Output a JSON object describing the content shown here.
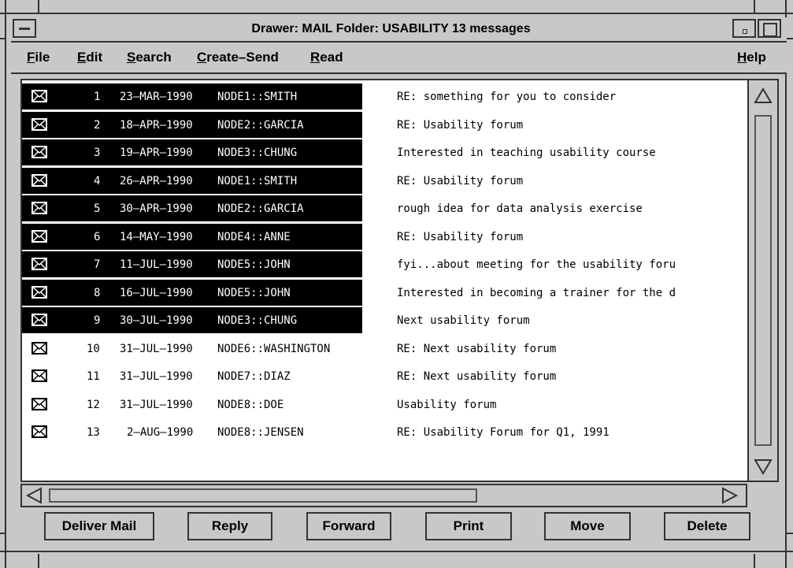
{
  "window": {
    "title": "Drawer: MAIL Folder: USABILITY 13 messages"
  },
  "menu": {
    "items": [
      {
        "label": "File",
        "mnemonic": "F"
      },
      {
        "label": "Edit",
        "mnemonic": "E"
      },
      {
        "label": "Search",
        "mnemonic": "S"
      },
      {
        "label": "Create–Send",
        "mnemonic": "C"
      },
      {
        "label": "Read",
        "mnemonic": "R"
      }
    ],
    "help": "Help"
  },
  "messages": [
    {
      "num": "1",
      "date": "23–MAR–1990",
      "from": "NODE1::SMITH",
      "subject": "RE: something for you to consider",
      "selected": true
    },
    {
      "num": "2",
      "date": "18–APR–1990",
      "from": "NODE2::GARCIA",
      "subject": "RE: Usability forum",
      "selected": true
    },
    {
      "num": "3",
      "date": "19–APR–1990",
      "from": "NODE3::CHUNG",
      "subject": "Interested in teaching usability course",
      "selected": true
    },
    {
      "num": "4",
      "date": "26–APR–1990",
      "from": "NODE1::SMITH",
      "subject": "RE: Usability forum",
      "selected": true
    },
    {
      "num": "5",
      "date": "30–APR–1990",
      "from": "NODE2::GARCIA",
      "subject": "rough idea for data analysis exercise",
      "selected": true
    },
    {
      "num": "6",
      "date": "14–MAY–1990",
      "from": "NODE4::ANNE",
      "subject": "RE: Usability forum",
      "selected": true
    },
    {
      "num": "7",
      "date": "11–JUL–1990",
      "from": "NODE5::JOHN",
      "subject": "fyi...about meeting for the usability foru",
      "selected": true
    },
    {
      "num": "8",
      "date": "16–JUL–1990",
      "from": "NODE5::JOHN",
      "subject": "Interested in becoming a trainer for the d",
      "selected": true
    },
    {
      "num": "9",
      "date": "30–JUL–1990",
      "from": "NODE3::CHUNG",
      "subject": "Next usability forum",
      "selected": true
    },
    {
      "num": "10",
      "date": "31–JUL–1990",
      "from": "NODE6::WASHINGTON",
      "subject": "RE: Next usability forum",
      "selected": false
    },
    {
      "num": "11",
      "date": "31–JUL–1990",
      "from": "NODE7::DIAZ",
      "subject": "RE: Next usability forum",
      "selected": false
    },
    {
      "num": "12",
      "date": "31–JUL–1990",
      "from": "NODE8::DOE",
      "subject": "Usability forum",
      "selected": false
    },
    {
      "num": "13",
      "date": "2–AUG–1990",
      "from": "NODE8::JENSEN",
      "subject": "RE: Usability Forum for Q1, 1991",
      "selected": false
    }
  ],
  "buttons": {
    "deliver": "Deliver Mail",
    "reply": "Reply",
    "forward": "Forward",
    "print": "Print",
    "move": "Move",
    "delete": "Delete"
  },
  "colors": {
    "chrome": "#c8c8c8",
    "selection": "#000000",
    "border": "#333333"
  }
}
